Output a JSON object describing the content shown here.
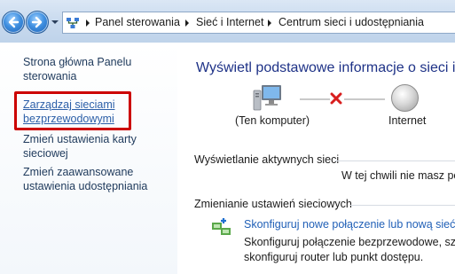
{
  "address_bar": {
    "breadcrumbs": [
      "Panel sterowania",
      "Sieć i Internet",
      "Centrum sieci i udostępniania"
    ]
  },
  "sidebar": {
    "items": [
      {
        "label_line1": "Strona główna Panelu",
        "label_line2": "sterowania"
      },
      {
        "label_line1": "Zarządzaj sieciami",
        "label_line2": "bezprzewodowymi",
        "highlighted": true,
        "highlight_color": "#cc0000"
      },
      {
        "label_line1": "Zmień ustawienia karty",
        "label_line2": "sieciowej"
      },
      {
        "label_line1": "Zmień zaawansowane",
        "label_line2": "ustawienia udostępniania"
      }
    ]
  },
  "main": {
    "heading": "Wyświetl podstawowe informacje o sieci i",
    "network_map": {
      "computer_label": "(Ten komputer)",
      "internet_label": "Internet",
      "connection_status_icon": "red-x-icon"
    },
    "active_networks": {
      "title": "Wyświetlanie aktywnych sieci",
      "status": "W tej chwili nie masz po"
    },
    "change_settings": {
      "title": "Zmienianie ustawień sieciowych",
      "task_link": "Skonfiguruj nowe połączenie lub nową sieć",
      "task_desc_line1": "Skonfiguruj połączenie bezprzewodowe, szerok",
      "task_desc_line2": "skonfiguruj router lub punkt dostępu."
    }
  },
  "colors": {
    "heading": "#1e3287",
    "link": "#2160b7",
    "highlight_box": "#cc0000"
  }
}
